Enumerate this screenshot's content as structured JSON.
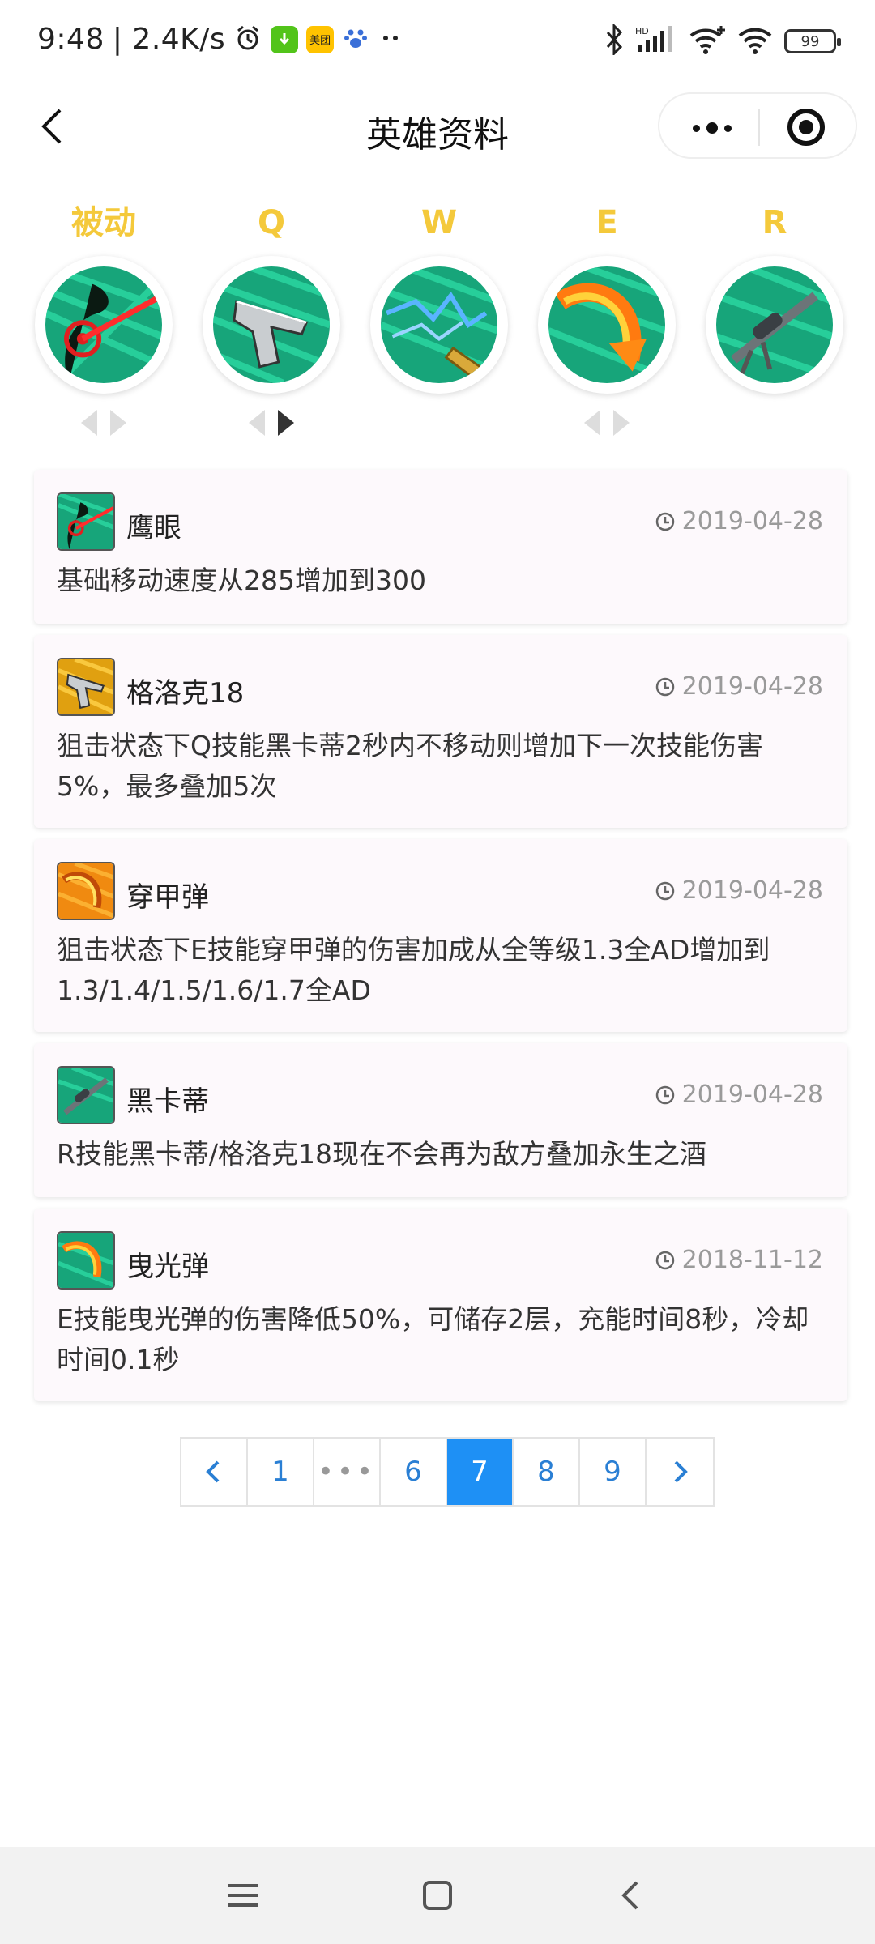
{
  "status_bar": {
    "time": "9:48",
    "speed": "| 2.4K/s",
    "app_icon_meituan": "美团",
    "battery": "99"
  },
  "header": {
    "title": "英雄资料"
  },
  "skills": [
    {
      "label": "被动",
      "icon": "hawkeye-skill-icon"
    },
    {
      "label": "Q",
      "icon": "pistol-skill-icon"
    },
    {
      "label": "W",
      "icon": "lightning-bullet-skill-icon"
    },
    {
      "label": "E",
      "icon": "fire-arc-skill-icon"
    },
    {
      "label": "R",
      "icon": "sniper-rifle-skill-icon"
    }
  ],
  "updates": [
    {
      "name": "鹰眼",
      "date": "2019-04-28",
      "desc": "基础移动速度从285增加到300"
    },
    {
      "name": "格洛克18",
      "date": "2019-04-28",
      "desc": "狙击状态下Q技能黑卡蒂2秒内不移动则增加下一次技能伤害5%，最多叠加5次"
    },
    {
      "name": "穿甲弹",
      "date": "2019-04-28",
      "desc": "狙击状态下E技能穿甲弹的伤害加成从全等级1.3全AD增加到1.3/1.4/1.5/1.6/1.7全AD"
    },
    {
      "name": "黑卡蒂",
      "date": "2019-04-28",
      "desc": "R技能黑卡蒂/格洛克18现在不会再为敌方叠加永生之酒"
    },
    {
      "name": "曳光弹",
      "date": "2018-11-12",
      "desc": "E技能曳光弹的伤害降低50%，可储存2层，充能时间8秒，冷却时间0.1秒"
    }
  ],
  "pagination": {
    "pages": [
      "1",
      "•••",
      "6",
      "7",
      "8",
      "9"
    ],
    "current": "7"
  },
  "colors": {
    "accent": "#1e90f5",
    "skill_label": "#f4c93b",
    "skill_bg": "#17a57a",
    "card_bg": "#fdf9fc"
  }
}
